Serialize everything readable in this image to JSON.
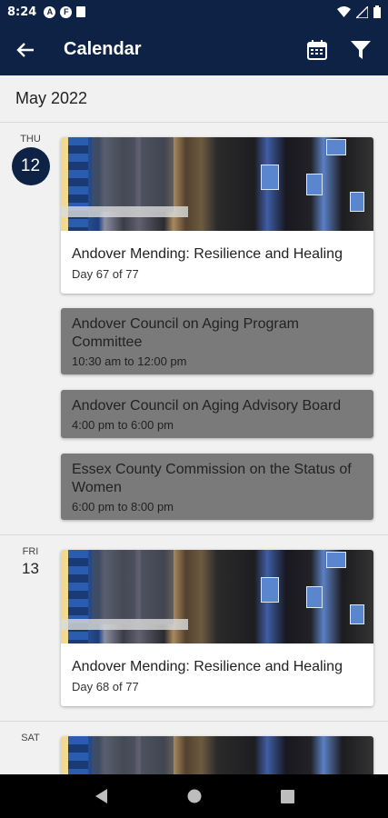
{
  "status_bar": {
    "time": "8:24",
    "notif1": "A",
    "notif2": "F"
  },
  "app_bar": {
    "title": "Calendar"
  },
  "month": "May 2022",
  "days": [
    {
      "dow": "THU",
      "num": "12",
      "featured": {
        "title": "Andover Mending: Resilience and Healing",
        "sub": "Day 67 of 77"
      },
      "events": [
        {
          "title": "Andover Council on Aging Program Committee",
          "time": "10:30 am to 12:00 pm"
        },
        {
          "title": "Andover Council on Aging Advisory Board",
          "time": "4:00 pm to 6:00 pm"
        },
        {
          "title": "Essex County Commission on the Status of Women",
          "time": "6:00 pm to 8:00 pm"
        }
      ]
    },
    {
      "dow": "FRI",
      "num": "13",
      "featured": {
        "title": "Andover Mending: Resilience and Healing",
        "sub": "Day 68 of 77"
      }
    },
    {
      "dow": "SAT"
    }
  ],
  "colors": {
    "primary": "#0d2244",
    "event_gray": "#7a7a7a",
    "background": "#f1f1f1"
  }
}
